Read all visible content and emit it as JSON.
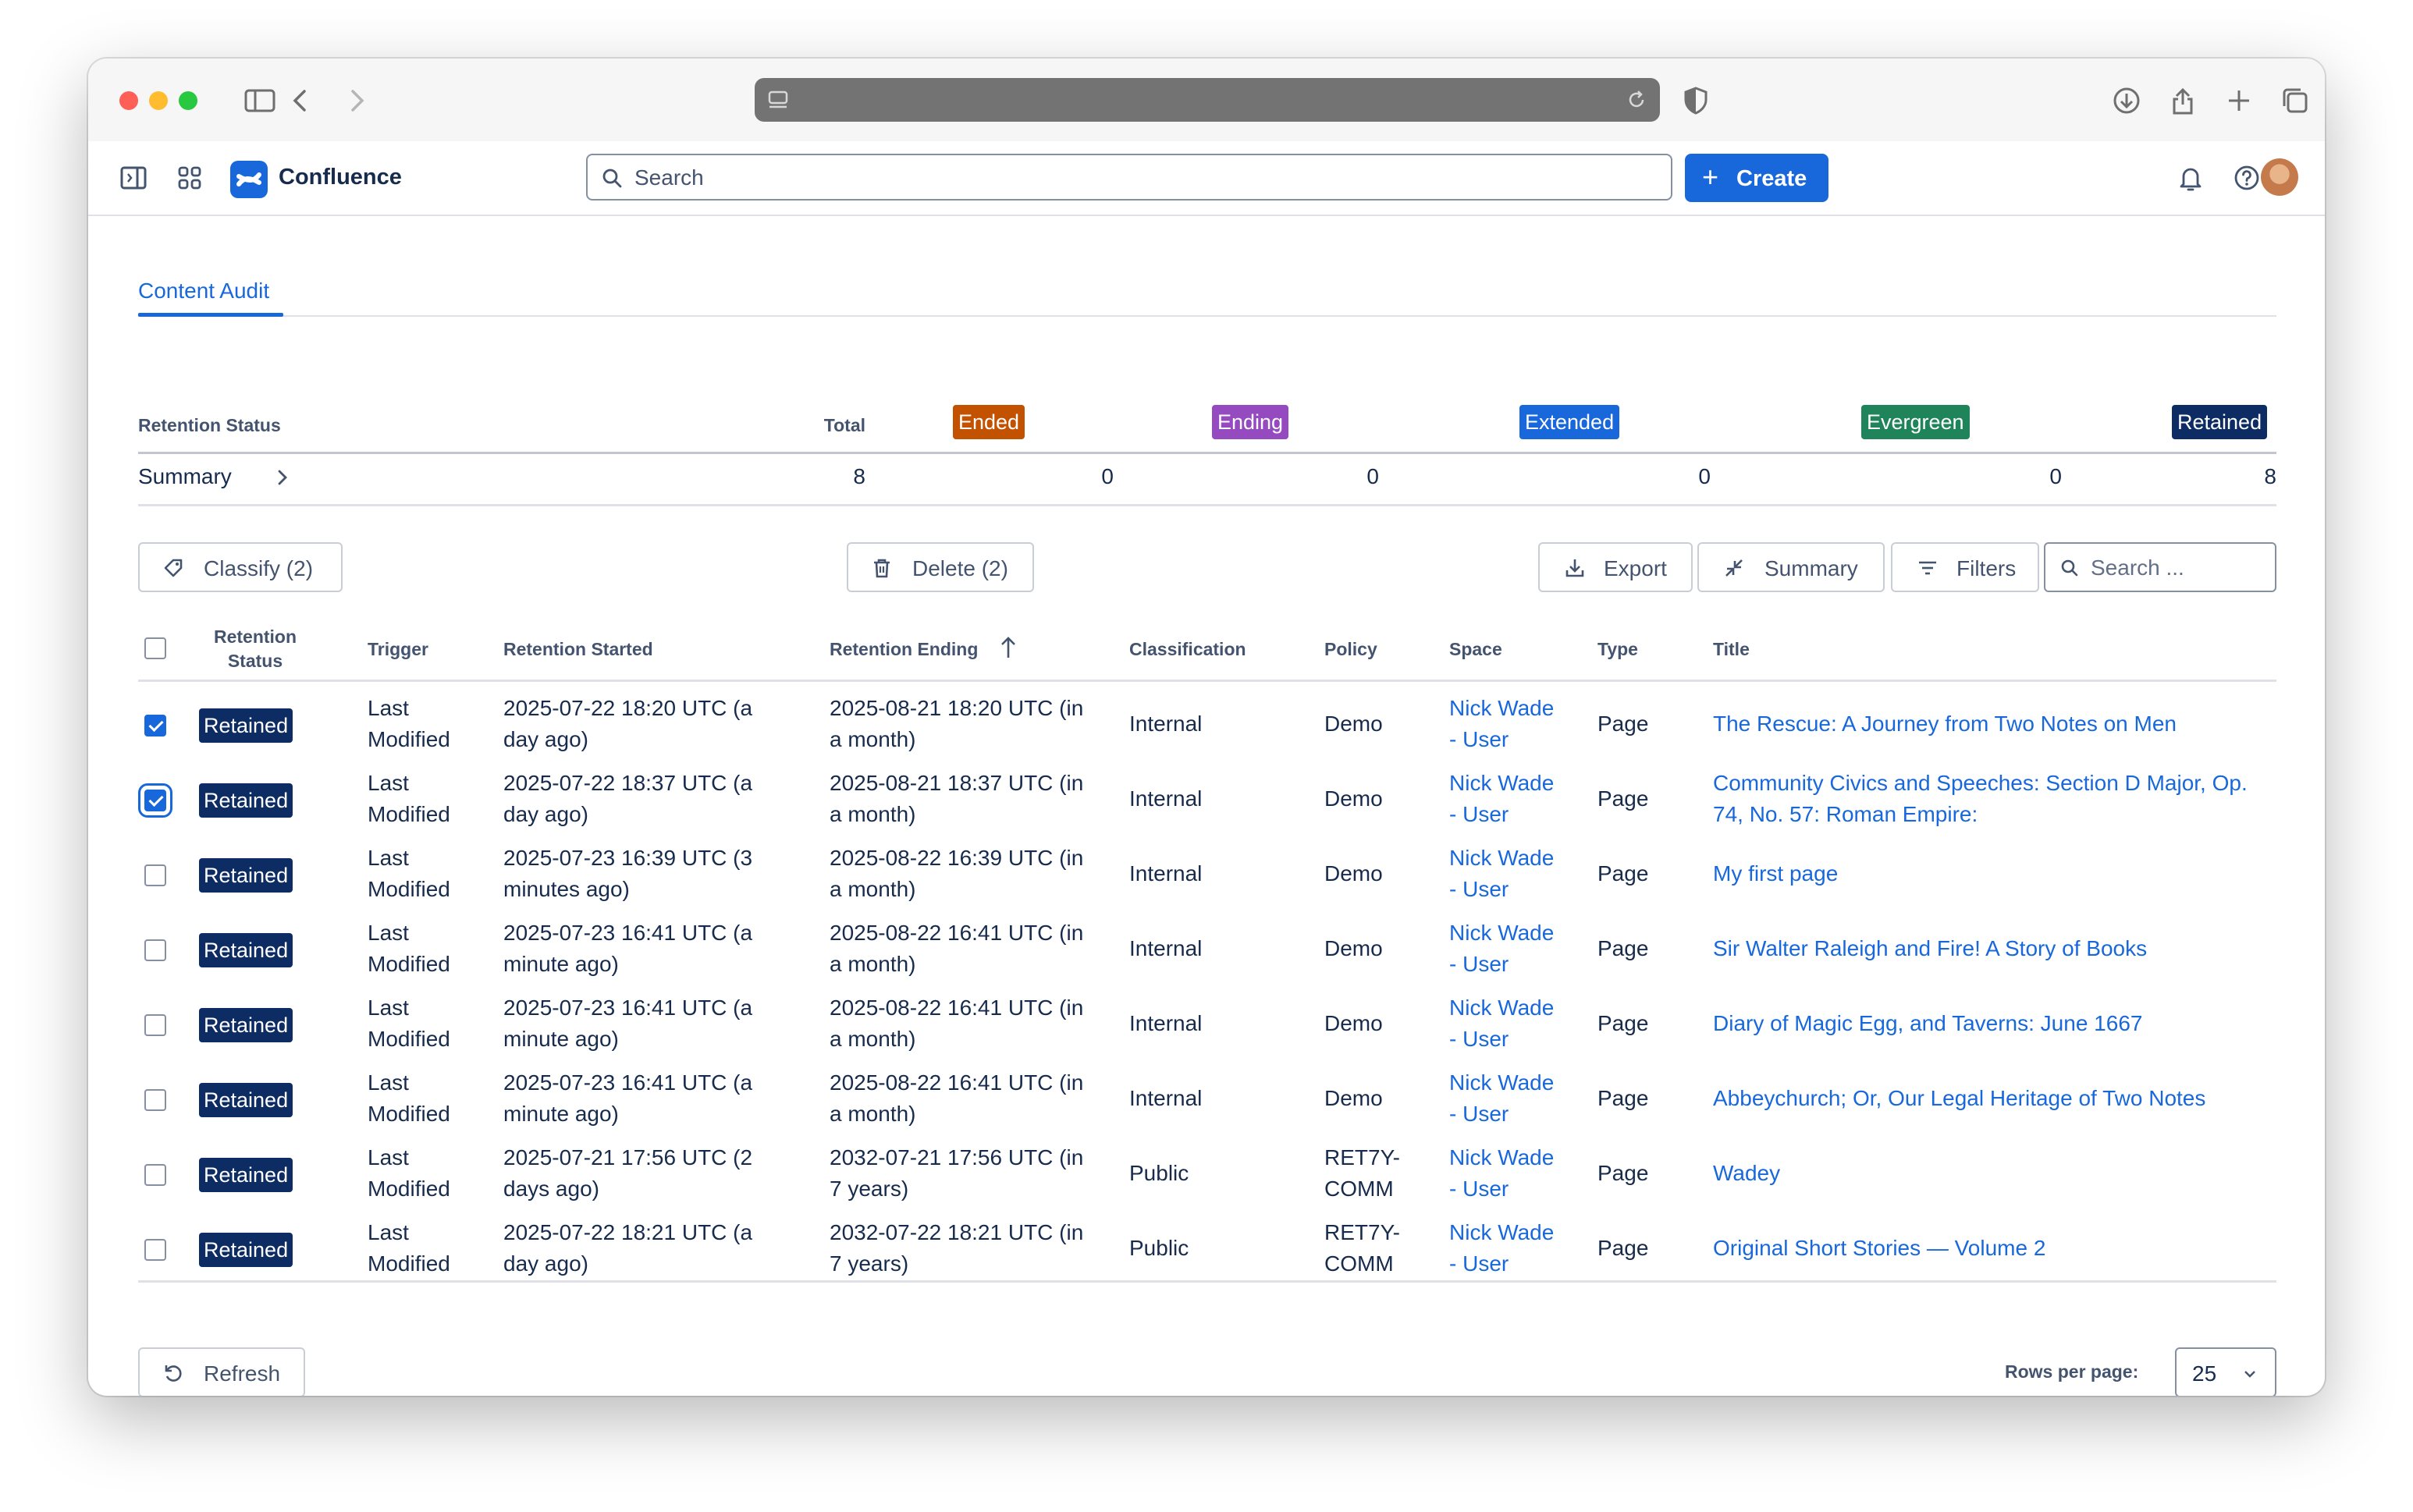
{
  "app": {
    "brand": "Confluence",
    "search_placeholder": "Search",
    "create_label": "Create"
  },
  "tab": {
    "label": "Content Audit"
  },
  "retention_summary": {
    "header_label": "Retention Status",
    "total_label": "Total",
    "row_label": "Summary",
    "total": "8",
    "statuses": [
      {
        "label": "Ended",
        "count": "0",
        "color": "#c25100"
      },
      {
        "label": "Ending",
        "count": "0",
        "color": "#964ac0"
      },
      {
        "label": "Extended",
        "count": "0",
        "color": "#1868db"
      },
      {
        "label": "Evergreen",
        "count": "0",
        "color": "#1f845a"
      },
      {
        "label": "Retained",
        "count": "8",
        "color": "#0c2c63"
      }
    ]
  },
  "toolbar": {
    "classify_label": "Classify (2)",
    "delete_label": "Delete (2)",
    "export_label": "Export",
    "summary_label": "Summary",
    "filters_label": "Filters",
    "search_placeholder": "Search ..."
  },
  "table": {
    "columns": {
      "status_line1": "Retention",
      "status_line2": "Status",
      "trigger": "Trigger",
      "started": "Retention Started",
      "ending": "Retention Ending",
      "classification": "Classification",
      "policy": "Policy",
      "space": "Space",
      "type": "Type",
      "title": "Title"
    },
    "rows": [
      {
        "checked": true,
        "status": "Retained",
        "trigger1": "Last",
        "trigger2": "Modified",
        "started1": "2025-07-22 18:20 UTC (a",
        "started2": "day ago)",
        "ending1": "2025-08-21 18:20 UTC (in",
        "ending2": "a month)",
        "classification": "Internal",
        "policy1": "Demo",
        "policy2": "",
        "space1": "Nick Wade",
        "space2": "- User",
        "type": "Page",
        "title1": "The Rescue: A Journey from Two Notes on Men",
        "title2": ""
      },
      {
        "checked": true,
        "status": "Retained",
        "trigger1": "Last",
        "trigger2": "Modified",
        "started1": "2025-07-22 18:37 UTC (a",
        "started2": "day ago)",
        "ending1": "2025-08-21 18:37 UTC (in",
        "ending2": "a month)",
        "classification": "Internal",
        "policy1": "Demo",
        "policy2": "",
        "space1": "Nick Wade",
        "space2": "- User",
        "type": "Page",
        "title1": "Community Civics and Speeches: Section D Major, Op.",
        "title2": "74, No. 57: Roman Empire:"
      },
      {
        "checked": false,
        "status": "Retained",
        "trigger1": "Last",
        "trigger2": "Modified",
        "started1": "2025-07-23 16:39 UTC (3",
        "started2": "minutes ago)",
        "ending1": "2025-08-22 16:39 UTC (in",
        "ending2": "a month)",
        "classification": "Internal",
        "policy1": "Demo",
        "policy2": "",
        "space1": "Nick Wade",
        "space2": "- User",
        "type": "Page",
        "title1": "My first page",
        "title2": ""
      },
      {
        "checked": false,
        "status": "Retained",
        "trigger1": "Last",
        "trigger2": "Modified",
        "started1": "2025-07-23 16:41 UTC (a",
        "started2": "minute ago)",
        "ending1": "2025-08-22 16:41 UTC (in",
        "ending2": "a month)",
        "classification": "Internal",
        "policy1": "Demo",
        "policy2": "",
        "space1": "Nick Wade",
        "space2": "- User",
        "type": "Page",
        "title1": "Sir Walter Raleigh and Fire! A Story of Books",
        "title2": ""
      },
      {
        "checked": false,
        "status": "Retained",
        "trigger1": "Last",
        "trigger2": "Modified",
        "started1": "2025-07-23 16:41 UTC (a",
        "started2": "minute ago)",
        "ending1": "2025-08-22 16:41 UTC (in",
        "ending2": "a month)",
        "classification": "Internal",
        "policy1": "Demo",
        "policy2": "",
        "space1": "Nick Wade",
        "space2": "- User",
        "type": "Page",
        "title1": "Diary of Magic Egg, and Taverns: June 1667",
        "title2": ""
      },
      {
        "checked": false,
        "status": "Retained",
        "trigger1": "Last",
        "trigger2": "Modified",
        "started1": "2025-07-23 16:41 UTC (a",
        "started2": "minute ago)",
        "ending1": "2025-08-22 16:41 UTC (in",
        "ending2": "a month)",
        "classification": "Internal",
        "policy1": "Demo",
        "policy2": "",
        "space1": "Nick Wade",
        "space2": "- User",
        "type": "Page",
        "title1": "Abbeychurch; Or, Our Legal Heritage of Two Notes",
        "title2": ""
      },
      {
        "checked": false,
        "status": "Retained",
        "trigger1": "Last",
        "trigger2": "Modified",
        "started1": "2025-07-21 17:56 UTC (2",
        "started2": "days ago)",
        "ending1": "2032-07-21 17:56 UTC (in",
        "ending2": "7 years)",
        "classification": "Public",
        "policy1": "RET7Y-",
        "policy2": "COMM",
        "space1": "Nick Wade",
        "space2": "- User",
        "type": "Page",
        "title1": "Wadey",
        "title2": ""
      },
      {
        "checked": false,
        "status": "Retained",
        "trigger1": "Last",
        "trigger2": "Modified",
        "started1": "2025-07-22 18:21 UTC (a",
        "started2": "day ago)",
        "ending1": "2032-07-22 18:21 UTC (in",
        "ending2": "7 years)",
        "classification": "Public",
        "policy1": "RET7Y-",
        "policy2": "COMM",
        "space1": "Nick Wade",
        "space2": "- User",
        "type": "Page",
        "title1": "Original Short Stories — Volume 2",
        "title2": ""
      }
    ]
  },
  "footer": {
    "refresh_label": "Refresh",
    "rows_per_page_label": "Rows per page:",
    "rows_per_page_value": "25"
  },
  "icons": {
    "sidebar": "sidebar-icon",
    "back": "chevron-left-icon",
    "forward": "chevron-right-icon",
    "download": "download-icon",
    "share": "share-icon",
    "new_tab": "plus-icon",
    "tabs": "tabs-icon",
    "notifications": "bell-icon",
    "help": "help-icon",
    "apps": "app-switcher-icon"
  }
}
